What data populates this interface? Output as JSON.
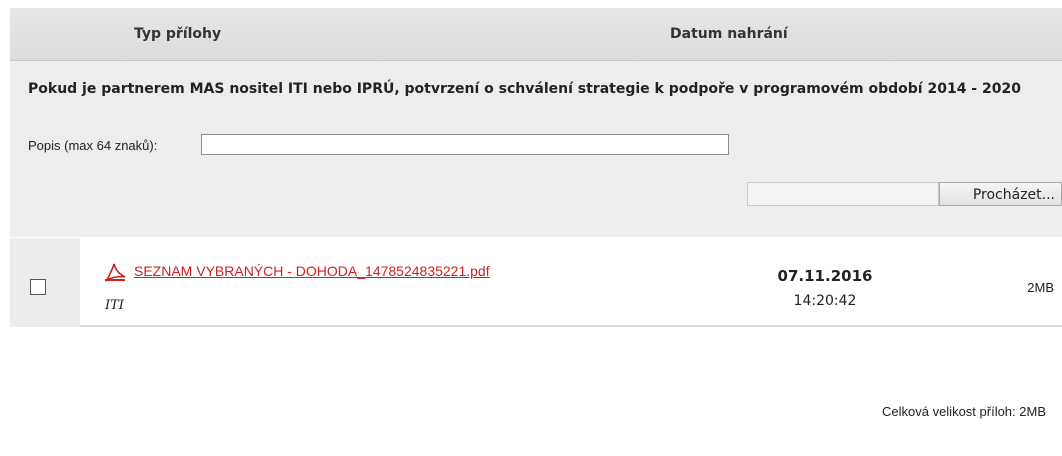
{
  "table": {
    "headers": {
      "type": "Typ přílohy",
      "date": "Datum nahrání"
    }
  },
  "upload": {
    "title": "Pokud je partnerem MAS nositel ITI nebo IPRÚ, potvrzení o schválení strategie k podpoře v programovém období 2014 - 2020",
    "description_label": "Popis (max 64 znaků):",
    "description_value": "",
    "file_path_value": "",
    "browse_label": "Procházet..."
  },
  "attachments": [
    {
      "checked": false,
      "filename": "SEZNAM VYBRANÝCH - DOHODA_1478524835221.pdf",
      "type": "ITI",
      "date": "07.11.2016",
      "time": "14:20:42",
      "size": "2MB",
      "icon": "pdf-icon"
    }
  ],
  "footer": {
    "total_size": "Celková velikost příloh: 2MB"
  },
  "colors": {
    "link": "#d02020",
    "header_bg": "#e0e0e0",
    "panel_bg": "#ededed"
  }
}
